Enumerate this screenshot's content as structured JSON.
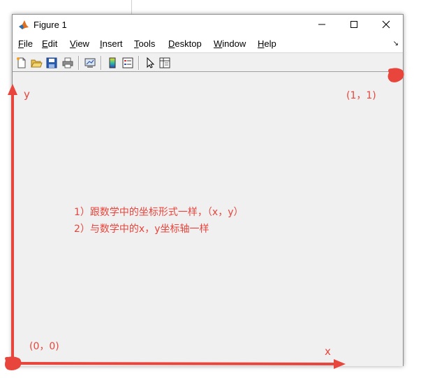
{
  "window": {
    "title": "Figure 1"
  },
  "menu": [
    "File",
    "Edit",
    "View",
    "Insert",
    "Tools",
    "Desktop",
    "Window",
    "Help"
  ],
  "toolbar_icons": [
    "new-figure-icon",
    "open-file-icon",
    "save-icon",
    "print-icon",
    "link-plot-icon",
    "colorbar-icon",
    "legend-icon",
    "pointer-icon",
    "property-inspector-icon"
  ],
  "annotations": {
    "top_right": "(1，1)",
    "bottom_left": "(0，0)",
    "x_axis": "x",
    "y_axis": "y",
    "note_1": "1）跟数学中的坐标形式一样，（x，y）",
    "note_2": "2）与数学中的x，y坐标轴一样"
  },
  "colors": {
    "annotation": "#e8453c",
    "window_bg": "#f0f0f0"
  }
}
